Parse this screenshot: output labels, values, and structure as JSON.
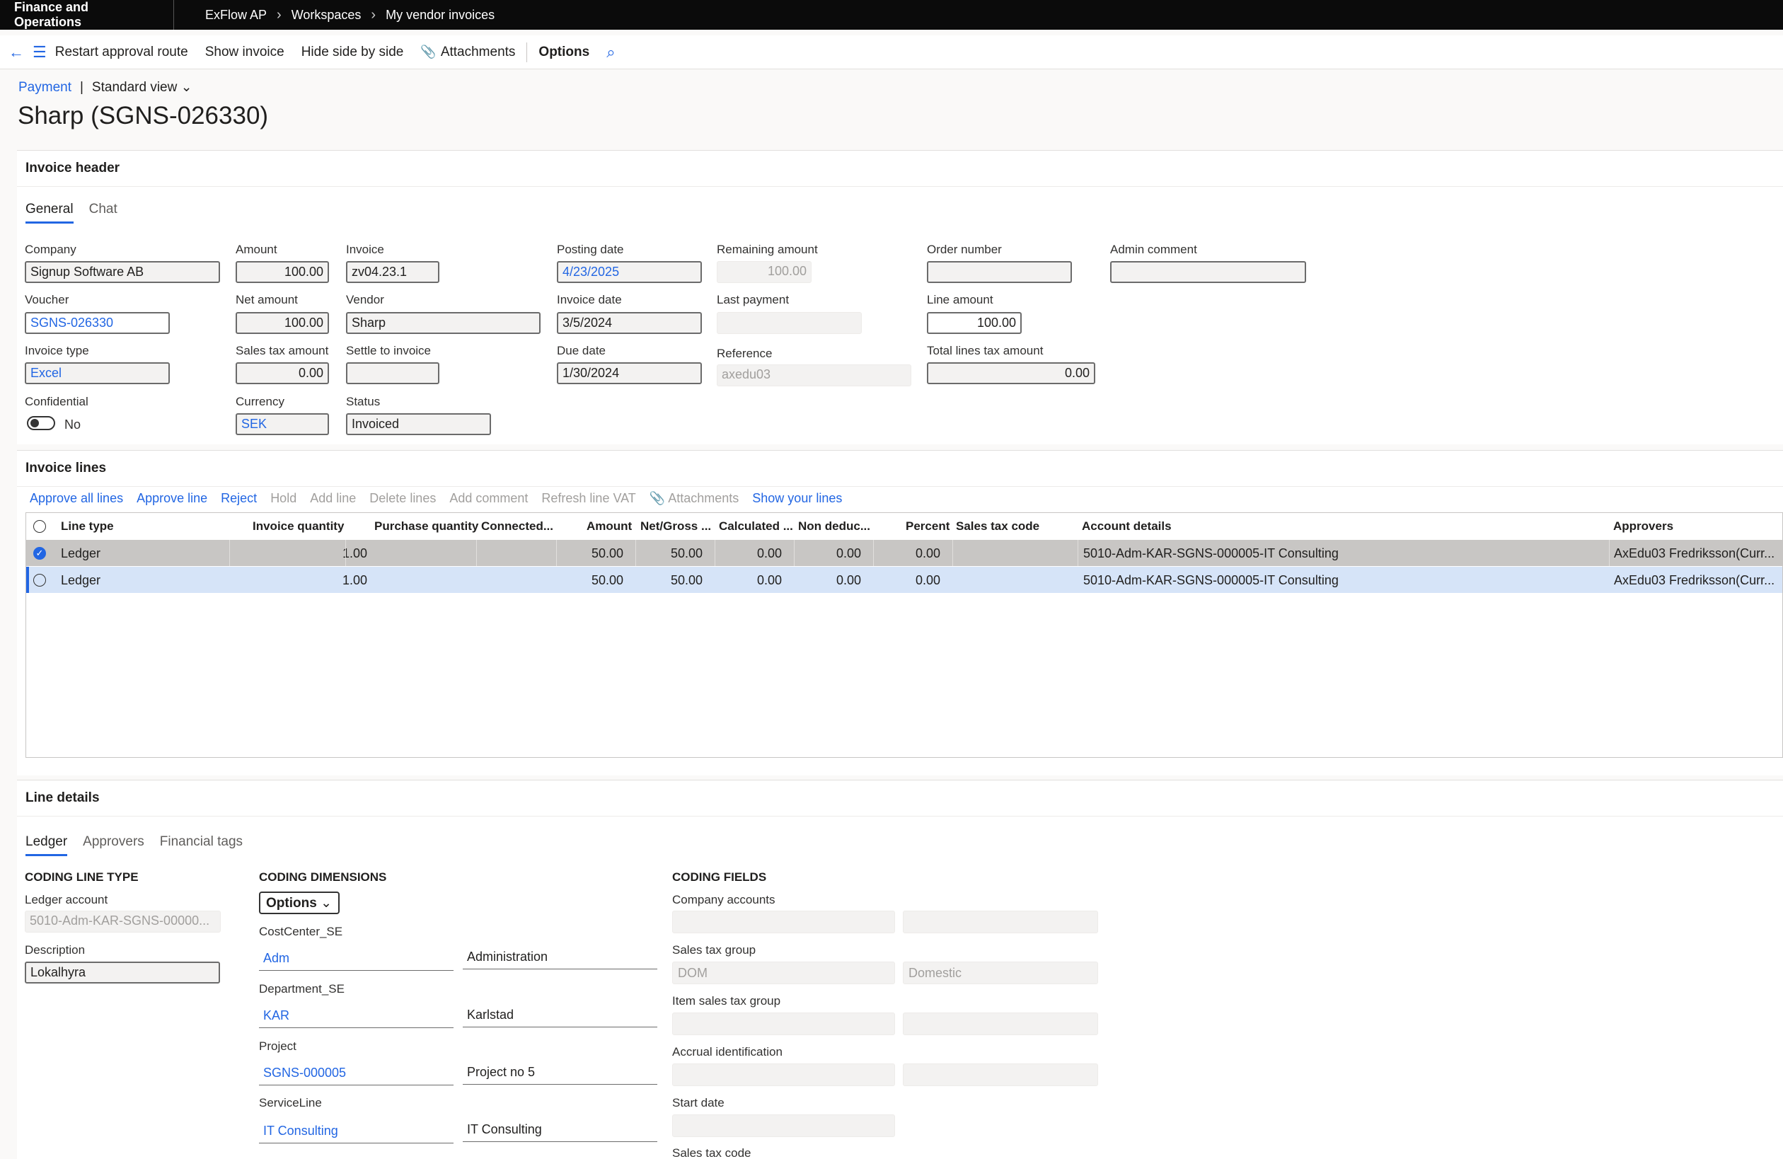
{
  "topbar": {
    "app": "Finance and Operations",
    "crumbs": [
      "ExFlow AP",
      "Workspaces",
      "My vendor invoices"
    ]
  },
  "actions": {
    "restart": "Restart approval route",
    "show_invoice": "Show invoice",
    "hide_side": "Hide side by side",
    "attachments": "Attachments",
    "options": "Options"
  },
  "subhead": {
    "link": "Payment",
    "sep": "|",
    "view": "Standard view"
  },
  "page_title": "Sharp (SGNS-026330)",
  "header": {
    "title": "Invoice header",
    "tabs": [
      "General",
      "Chat"
    ],
    "company": {
      "label": "Company",
      "value": "Signup Software AB"
    },
    "voucher": {
      "label": "Voucher",
      "value": "SGNS-026330"
    },
    "invoice_type": {
      "label": "Invoice type",
      "value": "Excel"
    },
    "confidential": {
      "label": "Confidential",
      "value": "No"
    },
    "amount": {
      "label": "Amount",
      "value": "100.00"
    },
    "net_amount": {
      "label": "Net amount",
      "value": "100.00"
    },
    "sales_tax": {
      "label": "Sales tax amount",
      "value": "0.00"
    },
    "currency": {
      "label": "Currency",
      "value": "SEK"
    },
    "invoice": {
      "label": "Invoice",
      "value": "zv04.23.1"
    },
    "vendor": {
      "label": "Vendor",
      "value": "Sharp"
    },
    "settle": {
      "label": "Settle to invoice",
      "value": ""
    },
    "status": {
      "label": "Status",
      "value": "Invoiced"
    },
    "posting_date": {
      "label": "Posting date",
      "value": "4/23/2025"
    },
    "invoice_date": {
      "label": "Invoice date",
      "value": "3/5/2024"
    },
    "due_date": {
      "label": "Due date",
      "value": "1/30/2024"
    },
    "remaining": {
      "label": "Remaining amount",
      "value": "100.00"
    },
    "last_payment": {
      "label": "Last payment",
      "value": ""
    },
    "reference": {
      "label": "Reference",
      "value": "axedu03"
    },
    "order_number": {
      "label": "Order number",
      "value": ""
    },
    "line_amount": {
      "label": "Line amount",
      "value": "100.00"
    },
    "total_lines_tax": {
      "label": "Total lines tax amount",
      "value": "0.00"
    },
    "admin_comment": {
      "label": "Admin comment",
      "value": ""
    }
  },
  "lines": {
    "title": "Invoice lines",
    "actions": [
      "Approve all lines",
      "Approve line",
      "Reject",
      "Hold",
      "Add line",
      "Delete lines",
      "Add comment",
      "Refresh line VAT",
      "Attachments",
      "Show your lines"
    ],
    "columns": [
      "Line type",
      "Invoice quantity",
      "Purchase quantity",
      "Connected...",
      "Amount",
      "Net/Gross ...",
      "Calculated ...",
      "Non deduc...",
      "Percent",
      "Sales tax code",
      "Account details",
      "Approvers"
    ],
    "rows": [
      {
        "type": "Ledger",
        "qty": "1.00",
        "pqty": "",
        "conn": "",
        "amount": "50.00",
        "net": "50.00",
        "calc": "0.00",
        "nonded": "0.00",
        "pct": "0.00",
        "taxcode": "",
        "account": "5010-Adm-KAR-SGNS-000005-IT Consulting",
        "approvers": "AxEdu03 Fredriksson(Curr..."
      },
      {
        "type": "Ledger",
        "qty": "1.00",
        "pqty": "",
        "conn": "",
        "amount": "50.00",
        "net": "50.00",
        "calc": "0.00",
        "nonded": "0.00",
        "pct": "0.00",
        "taxcode": "",
        "account": "5010-Adm-KAR-SGNS-000005-IT Consulting",
        "approvers": "AxEdu03 Fredriksson(Curr..."
      }
    ]
  },
  "details": {
    "title": "Line details",
    "tabs": [
      "Ledger",
      "Approvers",
      "Financial tags"
    ],
    "coding_line_type": "CODING LINE TYPE",
    "ledger_account": {
      "label": "Ledger account",
      "value": "5010-Adm-KAR-SGNS-00000..."
    },
    "description": {
      "label": "Description",
      "value": "Lokalhyra"
    },
    "coding_dimensions": "CODING DIMENSIONS",
    "options": "Options",
    "dims": [
      {
        "label": "CostCenter_SE",
        "code": "Adm",
        "name": "Administration"
      },
      {
        "label": "Department_SE",
        "code": "KAR",
        "name": "Karlstad"
      },
      {
        "label": "Project",
        "code": "SGNS-000005",
        "name": "Project no 5"
      },
      {
        "label": "ServiceLine",
        "code": "IT Consulting",
        "name": "IT Consulting"
      }
    ],
    "coding_fields": "CODING FIELDS",
    "company_accounts": {
      "label": "Company accounts",
      "v1": "",
      "v2": ""
    },
    "sales_tax_group": {
      "label": "Sales tax group",
      "v1": "DOM",
      "v2": "Domestic"
    },
    "item_sales_tax_group": {
      "label": "Item sales tax group",
      "v1": "",
      "v2": ""
    },
    "accrual": {
      "label": "Accrual identification",
      "v1": "",
      "v2": ""
    },
    "start_date": {
      "label": "Start date",
      "v1": ""
    },
    "sales_tax_code": {
      "label": "Sales tax code"
    }
  },
  "colors": {
    "accent": "#2266e3",
    "topbar": "#0b0b0b",
    "selected_row": "#d6e4f8"
  },
  "icons": [
    "back-arrow-icon",
    "menu-icon",
    "paperclip-icon",
    "search-icon",
    "chevron-down-icon",
    "chevron-right-icon",
    "check-icon"
  ]
}
